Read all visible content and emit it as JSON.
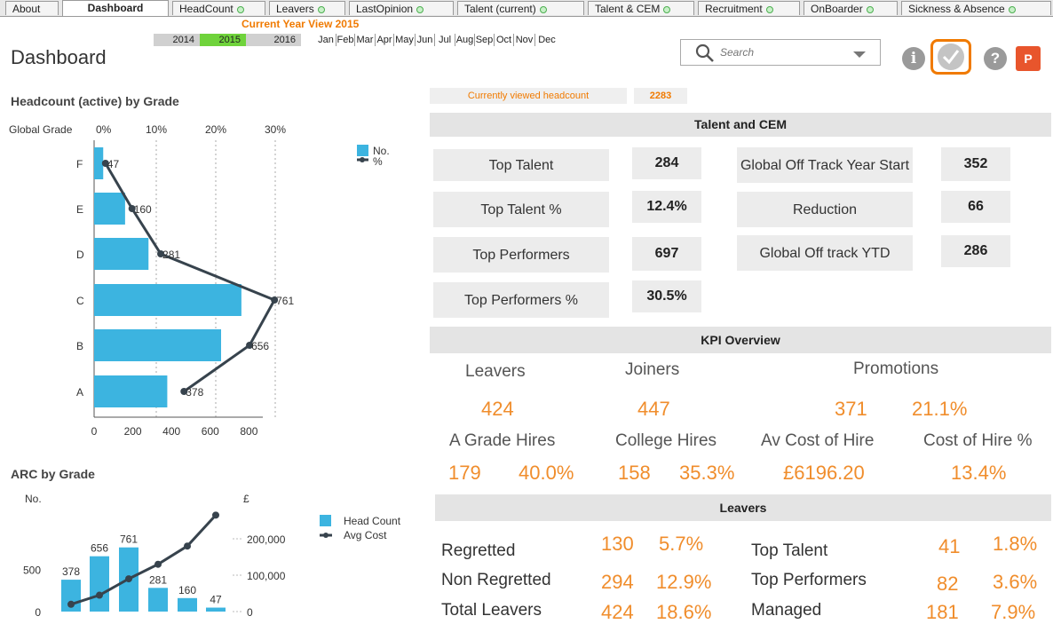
{
  "tabs": [
    {
      "label": "About",
      "dot": false
    },
    {
      "label": "Dashboard",
      "dot": false,
      "active": true
    },
    {
      "label": "HeadCount",
      "dot": true
    },
    {
      "label": "Leavers",
      "dot": true
    },
    {
      "label": "LastOpinion",
      "dot": true
    },
    {
      "label": "Talent (current)",
      "dot": true
    },
    {
      "label": "Talent & CEM",
      "dot": true
    },
    {
      "label": "Recruitment",
      "dot": true
    },
    {
      "label": "OnBoarder",
      "dot": true
    },
    {
      "label": "Sickness & Absence",
      "dot": true
    }
  ],
  "header": {
    "title": "Dashboard",
    "current_year_view": "Current Year View 2015",
    "years": [
      {
        "label": "2014",
        "selected": false
      },
      {
        "label": "2015",
        "selected": true
      },
      {
        "label": "2016",
        "selected": false
      }
    ],
    "months": [
      "Jan",
      "Feb",
      "Mar",
      "Apr",
      "May",
      "Jun",
      "Jul",
      "Aug",
      "Sep",
      "Oct",
      "Nov",
      "Dec"
    ],
    "search_placeholder": "Search",
    "icons": [
      "info-icon",
      "check-icon",
      "help-icon",
      "powerpoint-icon"
    ],
    "icon_glyphs": {
      "info": "i",
      "help": "?",
      "ppt": "P"
    }
  },
  "viewed": {
    "label": "Currently viewed headcount",
    "value": "2283"
  },
  "headcount_chart": {
    "title": "Headcount (active) by Grade",
    "axis_label": "Global Grade",
    "legend": [
      "No.",
      "%"
    ],
    "chart_data": {
      "type": "bar",
      "orientation": "horizontal",
      "categories": [
        "F",
        "E",
        "D",
        "C",
        "B",
        "A"
      ],
      "series": [
        {
          "name": "No.",
          "values": [
            47,
            160,
            281,
            761,
            656,
            378
          ]
        },
        {
          "name": "%",
          "values": [
            2.1,
            7.0,
            12.3,
            33.3,
            28.7,
            16.6
          ]
        }
      ],
      "xticks": [
        "0",
        "200",
        "400",
        "600",
        "800"
      ],
      "pct_ticks": [
        "0%",
        "10%",
        "20%",
        "30%"
      ],
      "xlim": [
        0,
        900
      ],
      "bar_color": "#3cb4e0",
      "line_color": "#37434d"
    }
  },
  "arc_chart": {
    "title": "ARC by Grade",
    "left_axis_label": "No.",
    "right_axis_label": "£",
    "legend": [
      "Head Count",
      "Avg Cost"
    ],
    "chart_data": {
      "type": "bar",
      "categories": [
        "A",
        "B",
        "C",
        "D",
        "E",
        "F"
      ],
      "series": [
        {
          "name": "Head Count",
          "values": [
            378,
            656,
            761,
            281,
            160,
            47
          ]
        },
        {
          "name": "Avg Cost",
          "values": [
            20000,
            45000,
            90000,
            130000,
            180000,
            265000
          ]
        }
      ],
      "left_ticks": [
        "0",
        "500"
      ],
      "right_ticks": [
        "0",
        "100,000",
        "200,000"
      ],
      "left_ylim": [
        0,
        900
      ],
      "right_ylim": [
        0,
        300000
      ],
      "bar_color": "#3cb4e0",
      "line_color": "#37434d"
    }
  },
  "talent": {
    "title": "Talent and CEM",
    "left": [
      {
        "label": "Top Talent",
        "value": "284"
      },
      {
        "label": "Top Talent %",
        "value": "12.4%"
      },
      {
        "label": "Top Performers",
        "value": "697"
      },
      {
        "label": "Top Performers %",
        "value": "30.5%"
      }
    ],
    "right": [
      {
        "label": "Global Off Track Year Start",
        "value": "352"
      },
      {
        "label": "Reduction",
        "value": "66"
      },
      {
        "label": "Global Off track YTD",
        "value": "286"
      }
    ]
  },
  "kpi": {
    "title": "KPI Overview",
    "leavers_label": "Leavers",
    "leavers": "424",
    "joiners_label": "Joiners",
    "joiners": "447",
    "promotions_label": "Promotions",
    "promotions": "371",
    "promotions_pct": "21.1%",
    "a_grade_label": "A Grade Hires",
    "a_grade": "179",
    "a_grade_pct": "40.0%",
    "college_label": "College Hires",
    "college": "158",
    "college_pct": "35.3%",
    "avcost_label": "Av Cost of Hire",
    "avcost": "£6196.20",
    "costpct_label": "Cost of Hire %",
    "costpct": "13.4%"
  },
  "leavers": {
    "title": "Leavers",
    "rows": [
      {
        "label": "Regretted",
        "value": "130",
        "pct": "5.7%"
      },
      {
        "label": "Non Regretted",
        "value": "294",
        "pct": "12.9%"
      },
      {
        "label": "Total Leavers",
        "value": "424",
        "pct": "18.6%"
      }
    ],
    "right_rows": [
      {
        "label": "Top Talent",
        "value": "41",
        "pct": "1.8%"
      },
      {
        "label": "Top Performers",
        "value": "82",
        "pct": "3.6%"
      },
      {
        "label": "Managed",
        "value": "181",
        "pct": "7.9%"
      }
    ]
  }
}
